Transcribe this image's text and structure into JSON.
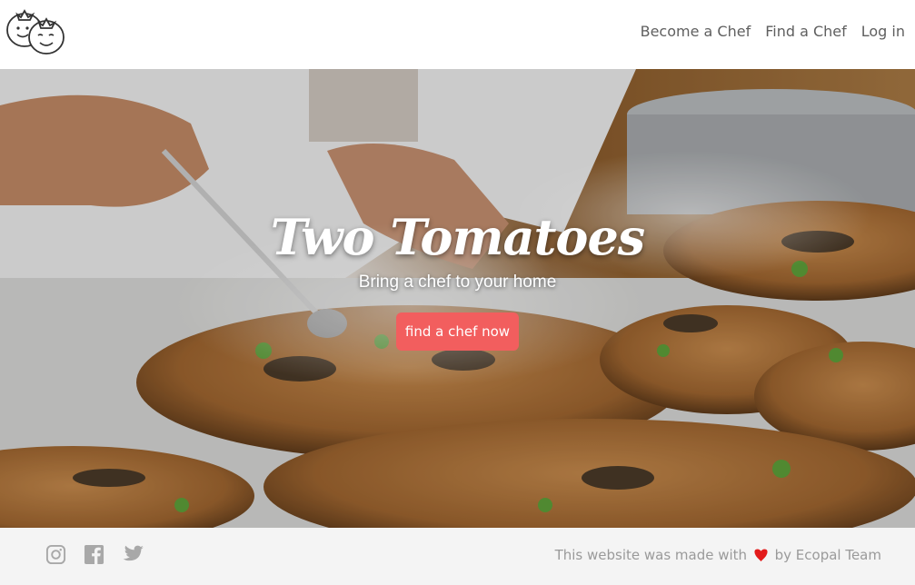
{
  "brand": {
    "logo_icon": "two-tomatoes-logo"
  },
  "nav": {
    "items": [
      {
        "label": "Become a Chef"
      },
      {
        "label": "Find a Chef"
      },
      {
        "label": "Log in"
      }
    ]
  },
  "hero": {
    "title": "Two Tomatoes",
    "subtitle": "Bring a chef to your home",
    "cta_label": "find a chef now",
    "cta_color": "#f25e5e"
  },
  "footer": {
    "social": [
      {
        "icon": "instagram-icon"
      },
      {
        "icon": "facebook-icon"
      },
      {
        "icon": "twitter-icon"
      }
    ],
    "credit_prefix": "This website was made with",
    "credit_suffix": "by Ecopal Team",
    "heart_color": "#e31b1b"
  }
}
